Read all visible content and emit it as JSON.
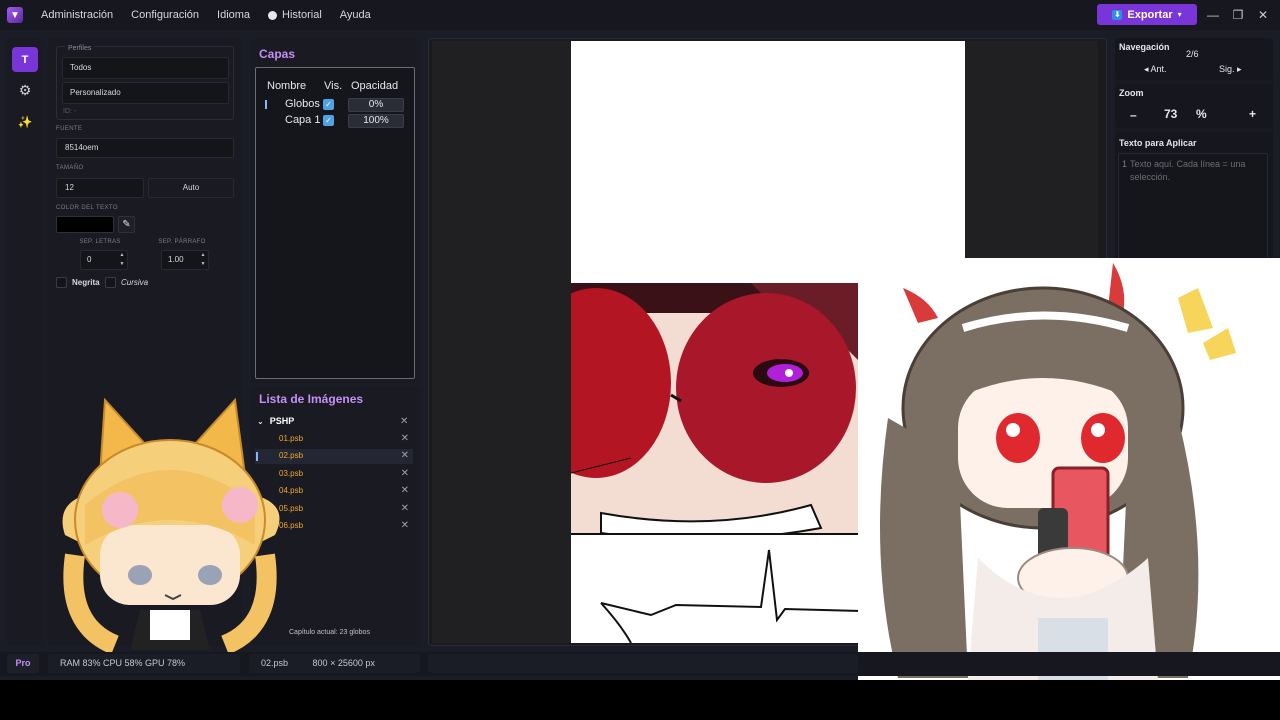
{
  "menubar": {
    "logo_glyph": "▼",
    "items": [
      "Administración",
      "Configuración",
      "Idioma",
      "Historial",
      "Ayuda"
    ],
    "export_label": "Exportar",
    "export_caret": "▾",
    "export_icon_glyph": "⬇",
    "win_minimize": "—",
    "win_restore": "❐",
    "win_close": "✕"
  },
  "rail": {
    "text_tool_label": "T",
    "settings_glyph": "⚙",
    "effects_glyph": "✨"
  },
  "text_panel": {
    "profiles_label": "Perfiles",
    "profile_all": "Todos",
    "profile_custom": "Personalizado",
    "profile_id": "ID: -",
    "font_label": "FUENTE",
    "font_value": "8514oem",
    "size_label": "TAMAÑO",
    "size_value": "12",
    "auto_label": "Auto",
    "color_label": "COLOR DEL TEXTO",
    "text_color": "#000000",
    "picker_glyph": "✎",
    "letter_spacing_label": "SEP. LETRAS",
    "letter_spacing_value": "0",
    "paragraph_spacing_label": "SEP. PÁRRAFO",
    "paragraph_spacing_value": "1.00",
    "spin_up": "▲",
    "spin_down": "▼",
    "bold_label": "Negrita",
    "italic_label": "Cursiva"
  },
  "layers": {
    "title": "Capas",
    "col_name": "Nombre",
    "col_vis": "Vis.",
    "col_opacity": "Opacidad",
    "check_glyph": "✓",
    "rows": [
      {
        "name": "Globos",
        "opacity": "0%"
      },
      {
        "name": "Capa 1",
        "opacity": "100%"
      }
    ]
  },
  "images": {
    "title": "Lista de Imágenes",
    "folder": "PSHP",
    "folder_caret": "⌄",
    "close_glyph": "✕",
    "files": [
      "01.psb",
      "02.psb",
      "03.psb",
      "04.psb",
      "05.psb",
      "06.psb"
    ],
    "chapter_status": "Capítulo actual: 23 globos"
  },
  "navigation": {
    "title": "Navegación",
    "page": "2/6",
    "prev": "◂ Ant.",
    "next": "Sig. ▸"
  },
  "zoom": {
    "title": "Zoom",
    "minus": "–",
    "value": "73",
    "unit": "%",
    "plus": "+"
  },
  "text_apply": {
    "title": "Texto para Aplicar",
    "line_number": "1",
    "placeholder": "Texto aquí. Cada línea = una selección."
  },
  "status": {
    "pro": "Pro",
    "resources": "RAM 83%  CPU 58%  GPU 78%",
    "file": "02.psb",
    "dimensions": "800 × 25600 px"
  },
  "colors": {
    "accent": "#7a35d8",
    "title_purple": "#c490f5",
    "file_orange": "#f0a830"
  }
}
